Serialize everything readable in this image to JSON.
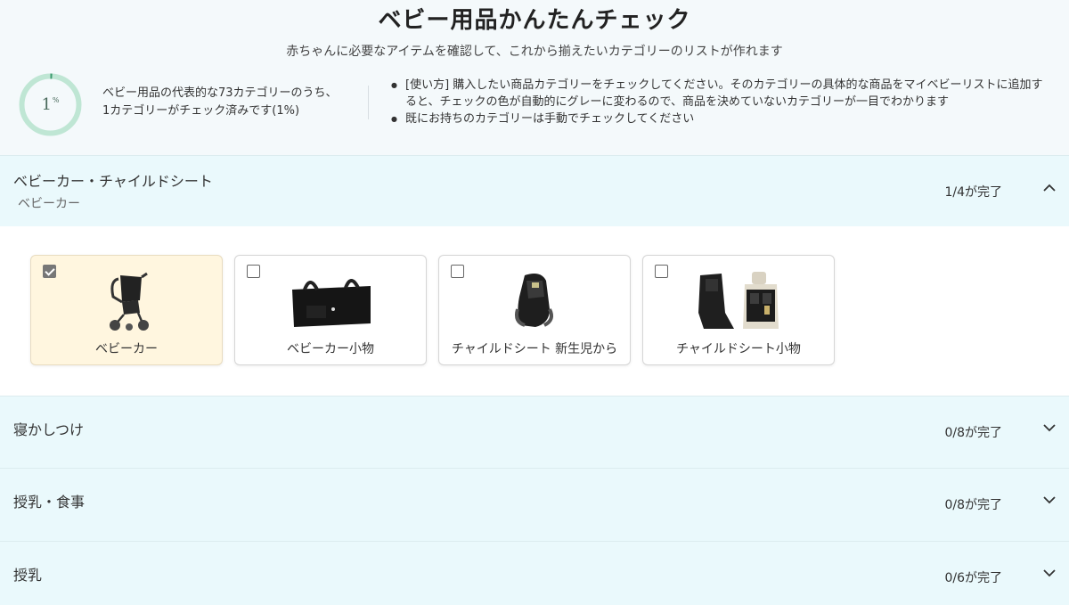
{
  "header": {
    "title": "ベビー用品かんたんチェック",
    "subtitle": "赤ちゃんに必要なアイテムを確認して、これから揃えたいカテゴリーのリストが作れます",
    "progress": {
      "value": "1",
      "unit": "%",
      "fraction": 0.01
    },
    "summary_line1": "ベビー用品の代表的な73カテゴリーのうち、",
    "summary_line2": "1カテゴリーがチェック済みです(1%)",
    "howto": [
      "[使い方] 購入したい商品カテゴリーをチェックしてください。そのカテゴリーの具体的な商品をマイベビーリストに追加すると、チェックの色が自動的にグレーに変わるので、商品を決めていないカテゴリーが一目でわかります",
      "既にお持ちのカテゴリーは手動でチェックしてください"
    ]
  },
  "sections": [
    {
      "name": "ベビーカー・チャイルドシート",
      "sub": "ベビーカー",
      "count": "1/4が完了",
      "expanded": true,
      "items": [
        {
          "label": "ベビーカー",
          "checked": true,
          "icon": "stroller-image"
        },
        {
          "label": "ベビーカー小物",
          "checked": false,
          "icon": "stroller-bag-image"
        },
        {
          "label": "チャイルドシート 新生児から",
          "checked": false,
          "icon": "child-seat-image"
        },
        {
          "label": "チャイルドシート小物",
          "checked": false,
          "icon": "seat-protector-image"
        }
      ]
    },
    {
      "name": "寝かしつけ",
      "count": "0/8が完了",
      "expanded": false
    },
    {
      "name": "授乳・食事",
      "count": "0/8が完了",
      "expanded": false
    },
    {
      "name": "授乳",
      "count": "0/6が完了",
      "expanded": false
    }
  ],
  "colors": {
    "accent_ring": "#a8dcc4",
    "section_bg": "#eaf9fc",
    "checked_card_bg": "#fff6df"
  }
}
